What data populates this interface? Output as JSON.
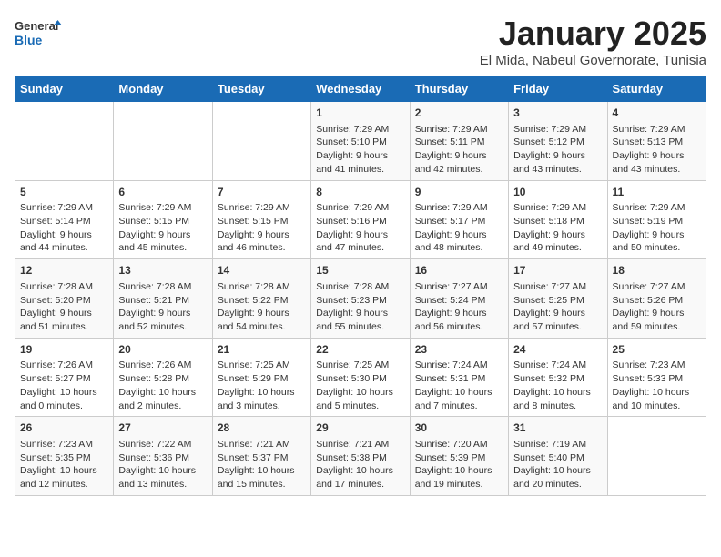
{
  "logo": {
    "line1": "General",
    "line2": "Blue"
  },
  "title": "January 2025",
  "subtitle": "El Mida, Nabeul Governorate, Tunisia",
  "days_of_week": [
    "Sunday",
    "Monday",
    "Tuesday",
    "Wednesday",
    "Thursday",
    "Friday",
    "Saturday"
  ],
  "weeks": [
    [
      {
        "day": "",
        "content": ""
      },
      {
        "day": "",
        "content": ""
      },
      {
        "day": "",
        "content": ""
      },
      {
        "day": "1",
        "content": "Sunrise: 7:29 AM\nSunset: 5:10 PM\nDaylight: 9 hours\nand 41 minutes."
      },
      {
        "day": "2",
        "content": "Sunrise: 7:29 AM\nSunset: 5:11 PM\nDaylight: 9 hours\nand 42 minutes."
      },
      {
        "day": "3",
        "content": "Sunrise: 7:29 AM\nSunset: 5:12 PM\nDaylight: 9 hours\nand 43 minutes."
      },
      {
        "day": "4",
        "content": "Sunrise: 7:29 AM\nSunset: 5:13 PM\nDaylight: 9 hours\nand 43 minutes."
      }
    ],
    [
      {
        "day": "5",
        "content": "Sunrise: 7:29 AM\nSunset: 5:14 PM\nDaylight: 9 hours\nand 44 minutes."
      },
      {
        "day": "6",
        "content": "Sunrise: 7:29 AM\nSunset: 5:15 PM\nDaylight: 9 hours\nand 45 minutes."
      },
      {
        "day": "7",
        "content": "Sunrise: 7:29 AM\nSunset: 5:15 PM\nDaylight: 9 hours\nand 46 minutes."
      },
      {
        "day": "8",
        "content": "Sunrise: 7:29 AM\nSunset: 5:16 PM\nDaylight: 9 hours\nand 47 minutes."
      },
      {
        "day": "9",
        "content": "Sunrise: 7:29 AM\nSunset: 5:17 PM\nDaylight: 9 hours\nand 48 minutes."
      },
      {
        "day": "10",
        "content": "Sunrise: 7:29 AM\nSunset: 5:18 PM\nDaylight: 9 hours\nand 49 minutes."
      },
      {
        "day": "11",
        "content": "Sunrise: 7:29 AM\nSunset: 5:19 PM\nDaylight: 9 hours\nand 50 minutes."
      }
    ],
    [
      {
        "day": "12",
        "content": "Sunrise: 7:28 AM\nSunset: 5:20 PM\nDaylight: 9 hours\nand 51 minutes."
      },
      {
        "day": "13",
        "content": "Sunrise: 7:28 AM\nSunset: 5:21 PM\nDaylight: 9 hours\nand 52 minutes."
      },
      {
        "day": "14",
        "content": "Sunrise: 7:28 AM\nSunset: 5:22 PM\nDaylight: 9 hours\nand 54 minutes."
      },
      {
        "day": "15",
        "content": "Sunrise: 7:28 AM\nSunset: 5:23 PM\nDaylight: 9 hours\nand 55 minutes."
      },
      {
        "day": "16",
        "content": "Sunrise: 7:27 AM\nSunset: 5:24 PM\nDaylight: 9 hours\nand 56 minutes."
      },
      {
        "day": "17",
        "content": "Sunrise: 7:27 AM\nSunset: 5:25 PM\nDaylight: 9 hours\nand 57 minutes."
      },
      {
        "day": "18",
        "content": "Sunrise: 7:27 AM\nSunset: 5:26 PM\nDaylight: 9 hours\nand 59 minutes."
      }
    ],
    [
      {
        "day": "19",
        "content": "Sunrise: 7:26 AM\nSunset: 5:27 PM\nDaylight: 10 hours\nand 0 minutes."
      },
      {
        "day": "20",
        "content": "Sunrise: 7:26 AM\nSunset: 5:28 PM\nDaylight: 10 hours\nand 2 minutes."
      },
      {
        "day": "21",
        "content": "Sunrise: 7:25 AM\nSunset: 5:29 PM\nDaylight: 10 hours\nand 3 minutes."
      },
      {
        "day": "22",
        "content": "Sunrise: 7:25 AM\nSunset: 5:30 PM\nDaylight: 10 hours\nand 5 minutes."
      },
      {
        "day": "23",
        "content": "Sunrise: 7:24 AM\nSunset: 5:31 PM\nDaylight: 10 hours\nand 7 minutes."
      },
      {
        "day": "24",
        "content": "Sunrise: 7:24 AM\nSunset: 5:32 PM\nDaylight: 10 hours\nand 8 minutes."
      },
      {
        "day": "25",
        "content": "Sunrise: 7:23 AM\nSunset: 5:33 PM\nDaylight: 10 hours\nand 10 minutes."
      }
    ],
    [
      {
        "day": "26",
        "content": "Sunrise: 7:23 AM\nSunset: 5:35 PM\nDaylight: 10 hours\nand 12 minutes."
      },
      {
        "day": "27",
        "content": "Sunrise: 7:22 AM\nSunset: 5:36 PM\nDaylight: 10 hours\nand 13 minutes."
      },
      {
        "day": "28",
        "content": "Sunrise: 7:21 AM\nSunset: 5:37 PM\nDaylight: 10 hours\nand 15 minutes."
      },
      {
        "day": "29",
        "content": "Sunrise: 7:21 AM\nSunset: 5:38 PM\nDaylight: 10 hours\nand 17 minutes."
      },
      {
        "day": "30",
        "content": "Sunrise: 7:20 AM\nSunset: 5:39 PM\nDaylight: 10 hours\nand 19 minutes."
      },
      {
        "day": "31",
        "content": "Sunrise: 7:19 AM\nSunset: 5:40 PM\nDaylight: 10 hours\nand 20 minutes."
      },
      {
        "day": "",
        "content": ""
      }
    ]
  ]
}
